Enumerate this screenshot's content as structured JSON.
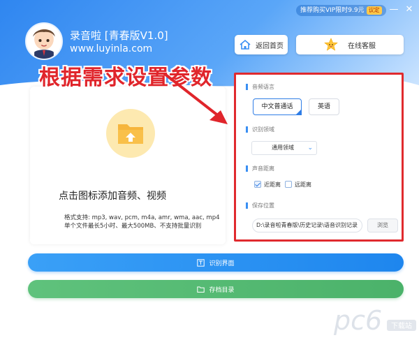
{
  "promo": {
    "text": "推荐购买VIP限时9.9元",
    "badge": "议定"
  },
  "window": {
    "minimize": "—",
    "close": "✕"
  },
  "header": {
    "title": "录音啦 [青春版V1.0]",
    "url": "www.luyinla.com"
  },
  "nav": {
    "home_label": "返回首页",
    "service_label": "在线客服"
  },
  "overlay": {
    "text": "根据需求设置参数"
  },
  "upload": {
    "title": "点击图标添加音频、视频",
    "formats": "格式支持: mp3, wav, pcm, m4a, amr, wma, aac, mp4",
    "limits": "单个文件最长5小时、最大500MB、不支持批量识别"
  },
  "settings": {
    "language": {
      "label": "音频语言",
      "options": [
        "中文普通话",
        "英语"
      ],
      "selected": "中文普通话"
    },
    "domain": {
      "label": "识别领域",
      "value": "通用领域"
    },
    "distance": {
      "label": "声音距离",
      "options": [
        {
          "label": "近距离",
          "checked": true
        },
        {
          "label": "远距离",
          "checked": false
        }
      ]
    },
    "save": {
      "label": "保存位置",
      "path": "D:\\录音啦青春版\\历史记录\\语音识别记录",
      "browse_label": "浏览"
    }
  },
  "actions": {
    "recognize_label": "识别界面",
    "archive_label": "存档目录"
  },
  "watermark": {
    "text": "pc6",
    "sub": "下载站"
  },
  "colors": {
    "accent": "#2f86f0",
    "highlight": "#e02a2e",
    "green": "#4bb26a"
  }
}
